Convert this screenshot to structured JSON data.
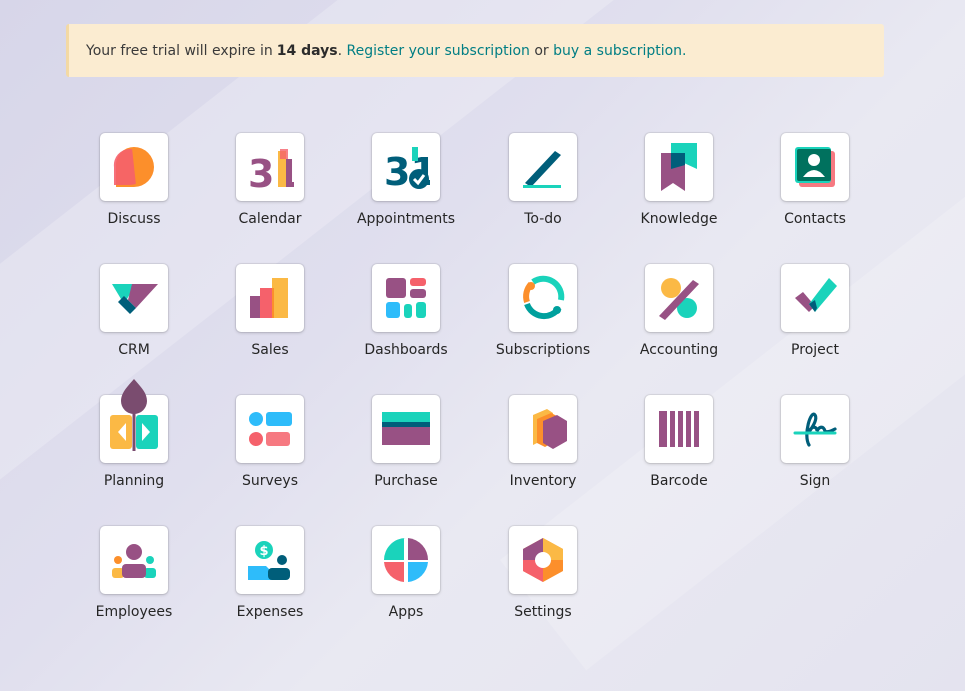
{
  "banner": {
    "prefix": "Your free trial will expire in",
    "days": "14 days",
    "period": ".",
    "register_link": "Register your subscription",
    "or_text": "or",
    "buy_link": "buy a subscription."
  },
  "apps": [
    {
      "label": "Discuss",
      "icon": "discuss-icon"
    },
    {
      "label": "Calendar",
      "icon": "calendar-icon"
    },
    {
      "label": "Appointments",
      "icon": "appointments-icon"
    },
    {
      "label": "To-do",
      "icon": "todo-icon"
    },
    {
      "label": "Knowledge",
      "icon": "knowledge-icon"
    },
    {
      "label": "Contacts",
      "icon": "contacts-icon"
    },
    {
      "label": "CRM",
      "icon": "crm-icon"
    },
    {
      "label": "Sales",
      "icon": "sales-icon"
    },
    {
      "label": "Dashboards",
      "icon": "dashboards-icon"
    },
    {
      "label": "Subscriptions",
      "icon": "subscriptions-icon"
    },
    {
      "label": "Accounting",
      "icon": "accounting-icon"
    },
    {
      "label": "Project",
      "icon": "project-icon"
    },
    {
      "label": "Planning",
      "icon": "planning-icon"
    },
    {
      "label": "Surveys",
      "icon": "surveys-icon"
    },
    {
      "label": "Purchase",
      "icon": "purchase-icon"
    },
    {
      "label": "Inventory",
      "icon": "inventory-icon"
    },
    {
      "label": "Barcode",
      "icon": "barcode-icon"
    },
    {
      "label": "Sign",
      "icon": "sign-icon"
    },
    {
      "label": "Employees",
      "icon": "employees-icon"
    },
    {
      "label": "Expenses",
      "icon": "expenses-icon"
    },
    {
      "label": "Apps",
      "icon": "apps-icon"
    },
    {
      "label": "Settings",
      "icon": "settings-icon"
    }
  ],
  "icon_texts": {
    "calendar_day": "31",
    "appointments_day": "31",
    "expenses_symbol": "$"
  },
  "colors": {
    "banner_bg": "#fbecd1",
    "link": "#017e84",
    "purple": "#985184",
    "teal": "#1ad3bb",
    "orange": "#fc8f2b",
    "red": "#f5616b",
    "dark_teal": "#005e7a",
    "blue": "#2ebcfa"
  }
}
